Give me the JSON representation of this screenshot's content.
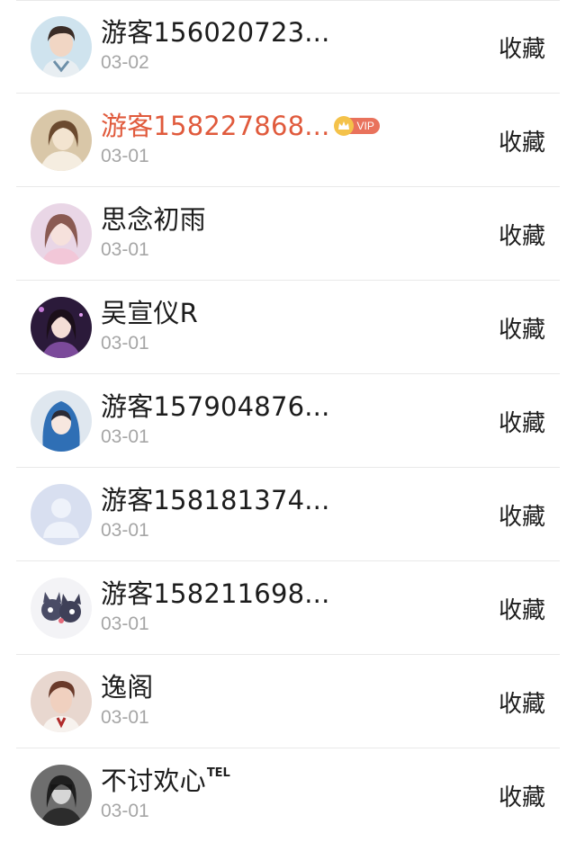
{
  "list": {
    "items": [
      {
        "name": "游客156020723...",
        "date": "03-02",
        "action": "收藏",
        "vip": false,
        "tel": "",
        "avatar": "young-man-avatar"
      },
      {
        "name": "游客158227868...",
        "date": "03-01",
        "action": "收藏",
        "vip": true,
        "vip_label": "VIP",
        "tel": "",
        "avatar": "woman-sepia-avatar"
      },
      {
        "name": "思念初雨",
        "date": "03-01",
        "action": "收藏",
        "vip": false,
        "tel": "",
        "avatar": "woman-pink-avatar"
      },
      {
        "name": "吴宣仪R",
        "date": "03-01",
        "action": "收藏",
        "vip": false,
        "tel": "",
        "avatar": "woman-stage-avatar"
      },
      {
        "name": "游客157904876...",
        "date": "03-01",
        "action": "收藏",
        "vip": false,
        "tel": "",
        "avatar": "anime-hood-avatar"
      },
      {
        "name": "游客158181374...",
        "date": "03-01",
        "action": "收藏",
        "vip": false,
        "tel": "",
        "avatar": "default-user-avatar"
      },
      {
        "name": "游客158211698...",
        "date": "03-01",
        "action": "收藏",
        "vip": false,
        "tel": "",
        "avatar": "cartoon-cats-avatar"
      },
      {
        "name": "逸阁",
        "date": "03-01",
        "action": "收藏",
        "vip": false,
        "tel": "",
        "avatar": "young-man-red-avatar"
      },
      {
        "name": "不讨欢心",
        "date": "03-01",
        "action": "收藏",
        "vip": false,
        "tel": "TEL",
        "avatar": "dark-portrait-avatar"
      }
    ]
  },
  "colors": {
    "vip_name": "#e05a3c",
    "text": "#1c1c1c",
    "date": "#a6a6a6",
    "divider": "#e9e9e9"
  }
}
